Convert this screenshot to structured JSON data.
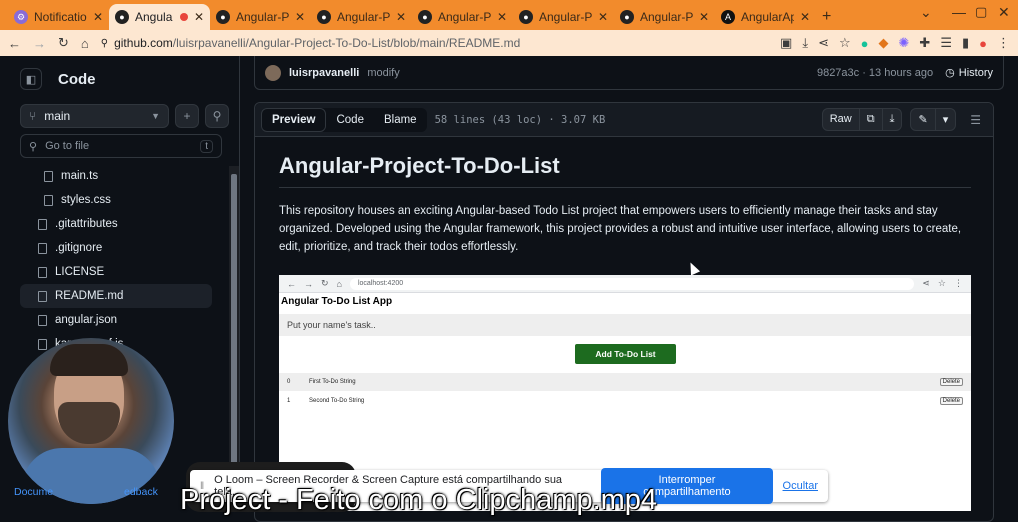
{
  "browser": {
    "tabs": [
      {
        "title": "Notificatio",
        "icon": "settings-tab-icon",
        "active": false
      },
      {
        "title": "Angula",
        "icon": "github-tab-icon",
        "active": true
      },
      {
        "title": "Angular-P",
        "icon": "github-tab-icon",
        "active": false
      },
      {
        "title": "Angular-P",
        "icon": "github-tab-icon",
        "active": false
      },
      {
        "title": "Angular-P",
        "icon": "github-tab-icon",
        "active": false
      },
      {
        "title": "Angular-P",
        "icon": "github-tab-icon",
        "active": false
      },
      {
        "title": "Angular-P",
        "icon": "github-tab-icon",
        "active": false
      },
      {
        "title": "AngularAp",
        "icon": "angular-tab-icon",
        "active": false
      }
    ],
    "url_host": "github.com",
    "url_path": "/luisrpavanelli/Angular-Project-To-Do-List/blob/main/README.md",
    "accent": "#f28b2c"
  },
  "sidebar": {
    "title": "Code",
    "branch": "main",
    "goto_placeholder": "Go to file",
    "goto_kbd": "t",
    "files": [
      {
        "name": "main.ts",
        "indent": true,
        "selected": false
      },
      {
        "name": "styles.css",
        "indent": true,
        "selected": false
      },
      {
        "name": ".gitattributes",
        "indent": false,
        "selected": false
      },
      {
        "name": ".gitignore",
        "indent": false,
        "selected": false
      },
      {
        "name": "LICENSE",
        "indent": false,
        "selected": false
      },
      {
        "name": "README.md",
        "indent": false,
        "selected": true
      },
      {
        "name": "angular.json",
        "indent": false,
        "selected": false
      },
      {
        "name": "karma.conf.js",
        "indent": false,
        "selected": false
      }
    ],
    "doc_left": "Docume",
    "doc_right": "edback"
  },
  "commit": {
    "user": "luisrpavanelli",
    "message": "modify",
    "sha_time": "9827a3c · 13 hours ago",
    "history_label": "History"
  },
  "file_header": {
    "tabs": [
      "Preview",
      "Code",
      "Blame"
    ],
    "active_tab": "Preview",
    "info": "58 lines (43 loc) · 3.07 KB",
    "raw_label": "Raw"
  },
  "readme": {
    "title": "Angular-Project-To-Do-List",
    "paragraph": "This repository houses an exciting Angular-based Todo List project that empowers users to efficiently manage their tasks and stay organized. Developed using the Angular framework, this project provides a robust and intuitive user interface, allowing users to create, edit, prioritize, and track their todos effortlessly."
  },
  "embedded_app": {
    "url": "localhost:4200",
    "title": "Angular To-Do List App",
    "input_placeholder": "Put your name's task..",
    "add_button": "Add To-Do List",
    "rows": [
      {
        "index": "0",
        "text": "First To-Do String",
        "action": "Delete"
      },
      {
        "index": "1",
        "text": "Second To-Do String",
        "action": "Delete"
      }
    ]
  },
  "loom": {
    "message": "O Loom – Screen Recorder & Screen Capture está compartilhando sua tela.",
    "stop_label": "Interromper compartilhamento",
    "hide_label": "Ocultar"
  },
  "caption": "Project - Feito com o Clipchamp.mp4"
}
